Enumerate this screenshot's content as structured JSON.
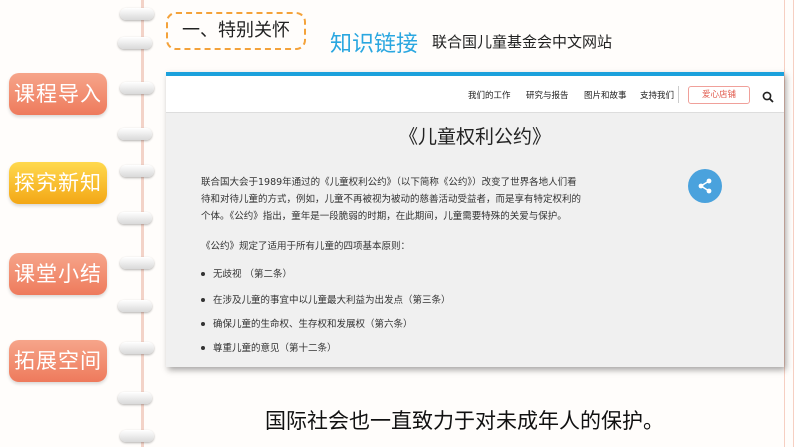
{
  "sidebar": {
    "items": [
      {
        "label": "课程导入"
      },
      {
        "label": "探究新知"
      },
      {
        "label": "课堂小结"
      },
      {
        "label": "拓展空间"
      }
    ]
  },
  "header": {
    "section_title": "一、特别关怀",
    "link_title": "知识链接",
    "link_subtitle": "联合国儿童基金会中文网站"
  },
  "website": {
    "nav": [
      "我们的工作",
      "研究与报告",
      "图片和故事",
      "支持我们"
    ],
    "shop_button": "爱心店铺",
    "article_title": "《儿童权利公约》",
    "paragraph_lines": [
      "联合国大会于1989年通过的《儿童权利公约》（以下简称《公约》）改变了世界各地人们看",
      "待和对待儿童的方式，例如，儿童不再被视为被动的慈善活动受益者，而是享有特定权利的",
      "个体。《公约》指出，童年是一段脆弱的时期，在此期间，儿童需要特殊的关爱与保护。"
    ],
    "principles_intro": "《公约》规定了适用于所有儿童的四项基本原则：",
    "principles": [
      "无歧视 （第二条）",
      "在涉及儿童的事宜中以儿童最大利益为出发点（第三条）",
      "确保儿童的生命权、生存权和发展权（第六条）",
      "尊重儿童的意见（第十二条）"
    ]
  },
  "caption": "国际社会也一直致力于对未成年人的保护。",
  "colors": {
    "nav_button": "#ee7a5c",
    "nav_button_active": "#f3a716",
    "accent_blue": "#2aa7e0",
    "dashed_border": "#f4a23a",
    "shop_red": "#e0574a"
  }
}
